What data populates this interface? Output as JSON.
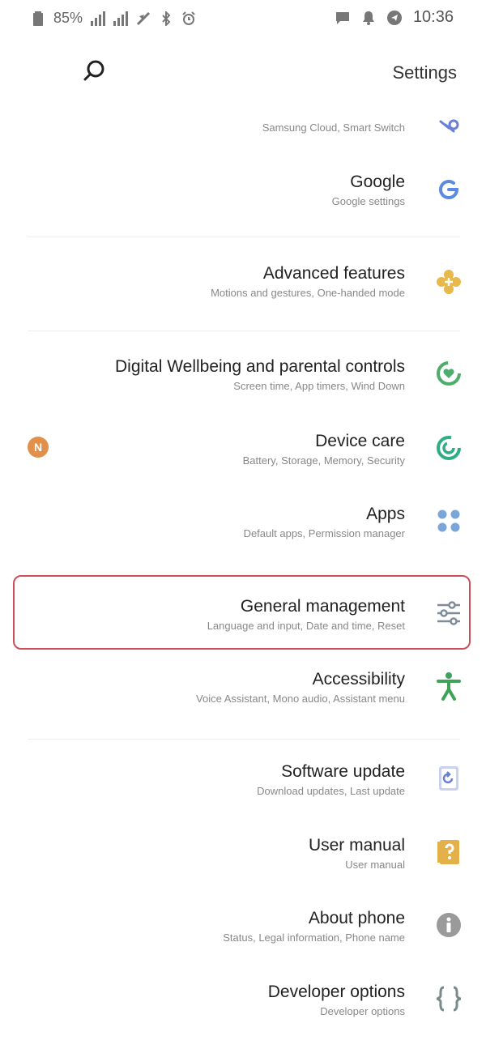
{
  "status_bar": {
    "time": "10:36",
    "battery_percent": "85%",
    "left_icons": [
      "battery-icon",
      "signal-icon",
      "signal-icon",
      "wifi-off-icon",
      "bluetooth-icon",
      "alarm-icon"
    ],
    "right_icons": [
      "message-icon",
      "notification-bell-icon",
      "navigation-icon"
    ]
  },
  "header": {
    "title": "Settings",
    "search_icon": "search-icon"
  },
  "settings": {
    "items": [
      {
        "title": "",
        "subtitle": "Samsung Cloud, Smart Switch",
        "icon": "key-icon",
        "icon_color": "#6a7fd6"
      },
      {
        "title": "Google",
        "subtitle": "Google settings",
        "icon": "google-icon",
        "icon_color": "#5b8be0"
      },
      {
        "title": "Advanced features",
        "subtitle": "Motions and gestures, One-handed mode",
        "icon": "advanced-features-icon",
        "icon_color": "#e8b84a"
      },
      {
        "title": "Digital Wellbeing and parental controls",
        "subtitle": "Screen time, App timers, Wind Down",
        "icon": "wellbeing-icon",
        "icon_color": "#4cae6a"
      },
      {
        "title": "Device care",
        "subtitle": "Battery, Storage, Memory, Security",
        "icon": "device-care-icon",
        "icon_color": "#2fae86",
        "badge": "N"
      },
      {
        "title": "Apps",
        "subtitle": "Default apps, Permission manager",
        "icon": "apps-icon",
        "icon_color": "#7aa6d9"
      },
      {
        "title": "General management",
        "subtitle": "Language and input, Date and time, Reset",
        "icon": "general-management-icon",
        "icon_color": "#7e8c9a"
      },
      {
        "title": "Accessibility",
        "subtitle": "Voice Assistant, Mono audio, Assistant menu",
        "icon": "accessibility-icon",
        "icon_color": "#3fa25a"
      },
      {
        "title": "Software update",
        "subtitle": "Download updates, Last update",
        "icon": "software-update-icon",
        "icon_color": "#6a7fd6"
      },
      {
        "title": "User manual",
        "subtitle": "User manual",
        "icon": "user-manual-icon",
        "icon_color": "#e3b04a"
      },
      {
        "title": "About phone",
        "subtitle": "Status, Legal information, Phone name",
        "icon": "info-icon",
        "icon_color": "#9a9a9a"
      },
      {
        "title": "Developer options",
        "subtitle": "Developer options",
        "icon": "developer-options-icon",
        "icon_color": "#7a8a8a"
      }
    ]
  }
}
